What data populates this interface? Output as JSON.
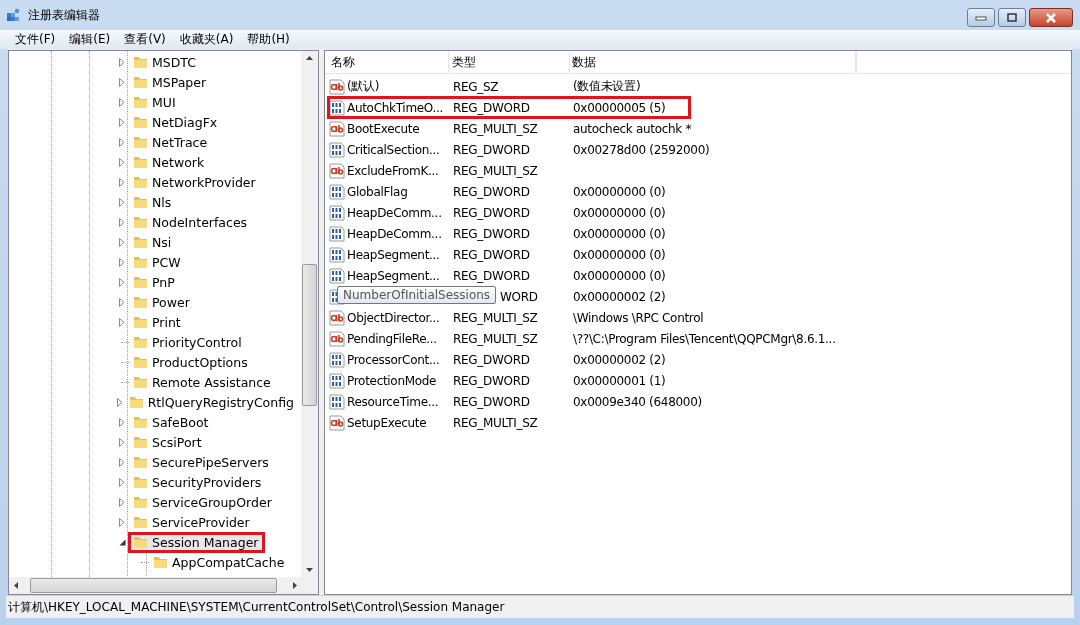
{
  "window": {
    "title": "注册表编辑器"
  },
  "menu": [
    "文件(F)",
    "编辑(E)",
    "查看(V)",
    "收藏夹(A)",
    "帮助(H)"
  ],
  "tree": {
    "items": [
      {
        "label": "MSDTC",
        "expandable": true,
        "expanded": false,
        "selected": false,
        "marked": false
      },
      {
        "label": "MSPaper",
        "expandable": true,
        "expanded": false,
        "selected": false,
        "marked": false
      },
      {
        "label": "MUI",
        "expandable": true,
        "expanded": false,
        "selected": false,
        "marked": false
      },
      {
        "label": "NetDiagFx",
        "expandable": true,
        "expanded": false,
        "selected": false,
        "marked": false
      },
      {
        "label": "NetTrace",
        "expandable": true,
        "expanded": false,
        "selected": false,
        "marked": false
      },
      {
        "label": "Network",
        "expandable": true,
        "expanded": false,
        "selected": false,
        "marked": false
      },
      {
        "label": "NetworkProvider",
        "expandable": true,
        "expanded": false,
        "selected": false,
        "marked": false
      },
      {
        "label": "Nls",
        "expandable": true,
        "expanded": false,
        "selected": false,
        "marked": false
      },
      {
        "label": "NodeInterfaces",
        "expandable": true,
        "expanded": false,
        "selected": false,
        "marked": false
      },
      {
        "label": "Nsi",
        "expandable": true,
        "expanded": false,
        "selected": false,
        "marked": false
      },
      {
        "label": "PCW",
        "expandable": true,
        "expanded": false,
        "selected": false,
        "marked": false
      },
      {
        "label": "PnP",
        "expandable": true,
        "expanded": false,
        "selected": false,
        "marked": false
      },
      {
        "label": "Power",
        "expandable": true,
        "expanded": false,
        "selected": false,
        "marked": false
      },
      {
        "label": "Print",
        "expandable": true,
        "expanded": false,
        "selected": false,
        "marked": false
      },
      {
        "label": "PriorityControl",
        "expandable": false,
        "expanded": false,
        "selected": false,
        "marked": false
      },
      {
        "label": "ProductOptions",
        "expandable": false,
        "expanded": false,
        "selected": false,
        "marked": false
      },
      {
        "label": "Remote Assistance",
        "expandable": false,
        "expanded": false,
        "selected": false,
        "marked": false
      },
      {
        "label": "RtlQueryRegistryConfig",
        "expandable": true,
        "expanded": false,
        "selected": false,
        "marked": false
      },
      {
        "label": "SafeBoot",
        "expandable": true,
        "expanded": false,
        "selected": false,
        "marked": false
      },
      {
        "label": "ScsiPort",
        "expandable": true,
        "expanded": false,
        "selected": false,
        "marked": false
      },
      {
        "label": "SecurePipeServers",
        "expandable": true,
        "expanded": false,
        "selected": false,
        "marked": false
      },
      {
        "label": "SecurityProviders",
        "expandable": true,
        "expanded": false,
        "selected": false,
        "marked": false
      },
      {
        "label": "ServiceGroupOrder",
        "expandable": true,
        "expanded": false,
        "selected": false,
        "marked": false
      },
      {
        "label": "ServiceProvider",
        "expandable": true,
        "expanded": false,
        "selected": false,
        "marked": false
      },
      {
        "label": "Session Manager",
        "expandable": true,
        "expanded": true,
        "selected": true,
        "marked": true,
        "children": [
          {
            "label": "AppCompatCache",
            "expandable": false,
            "expanded": false,
            "selected": false,
            "marked": false
          }
        ]
      }
    ]
  },
  "table": {
    "columns": [
      "名称",
      "类型",
      "数据"
    ],
    "rows": [
      {
        "kind": "string",
        "name": "(默认)",
        "type": "REG_SZ",
        "data": "(数值未设置)",
        "marked": false
      },
      {
        "kind": "binary",
        "name": "AutoChkTimeO...",
        "type": "REG_DWORD",
        "data": "0x00000005 (5)",
        "marked": true
      },
      {
        "kind": "string",
        "name": "BootExecute",
        "type": "REG_MULTI_SZ",
        "data": "autocheck autochk *",
        "marked": false
      },
      {
        "kind": "binary",
        "name": "CriticalSection...",
        "type": "REG_DWORD",
        "data": "0x00278d00 (2592000)",
        "marked": false
      },
      {
        "kind": "string",
        "name": "ExcludeFromK...",
        "type": "REG_MULTI_SZ",
        "marked": false
      },
      {
        "kind": "binary",
        "name": "GlobalFlag",
        "type": "REG_DWORD",
        "data": "0x00000000 (0)",
        "marked": false
      },
      {
        "kind": "binary",
        "name": "HeapDeComm...",
        "type": "REG_DWORD",
        "data": "0x00000000 (0)",
        "marked": false
      },
      {
        "kind": "binary",
        "name": "HeapDeComm...",
        "type": "REG_DWORD",
        "data": "0x00000000 (0)",
        "marked": false
      },
      {
        "kind": "binary",
        "name": "HeapSegment...",
        "type": "REG_DWORD",
        "data": "0x00000000 (0)",
        "marked": false
      },
      {
        "kind": "binary",
        "name": "HeapSegment...",
        "type": "REG_DWORD",
        "data": "0x00000000 (0)",
        "marked": false
      },
      {
        "kind": "binary",
        "type": "WORD",
        "data": "0x00000002 (2)",
        "marked": false,
        "tooltip": "NumberOfInitialSessions"
      },
      {
        "kind": "string",
        "name": "ObjectDirector...",
        "type": "REG_MULTI_SZ",
        "data": "\\Windows \\RPC Control",
        "marked": false
      },
      {
        "kind": "string",
        "name": "PendingFileRe...",
        "type": "REG_MULTI_SZ",
        "data": "\\??\\C:\\Program Files\\Tencent\\QQPCMgr\\8.6.1...",
        "marked": false
      },
      {
        "kind": "binary",
        "name": "ProcessorCont...",
        "type": "REG_DWORD",
        "data": "0x00000002 (2)",
        "marked": false
      },
      {
        "kind": "binary",
        "name": "ProtectionMode",
        "type": "REG_DWORD",
        "data": "0x00000001 (1)",
        "marked": false
      },
      {
        "kind": "binary",
        "name": "ResourceTime...",
        "type": "REG_DWORD",
        "data": "0x0009e340 (648000)",
        "marked": false
      },
      {
        "kind": "string",
        "name": "SetupExecute",
        "type": "REG_MULTI_SZ",
        "marked": false
      }
    ]
  },
  "status_bar": "计算机\\HKEY_LOCAL_MACHINE\\SYSTEM\\CurrentControlSet\\Control\\Session Manager"
}
